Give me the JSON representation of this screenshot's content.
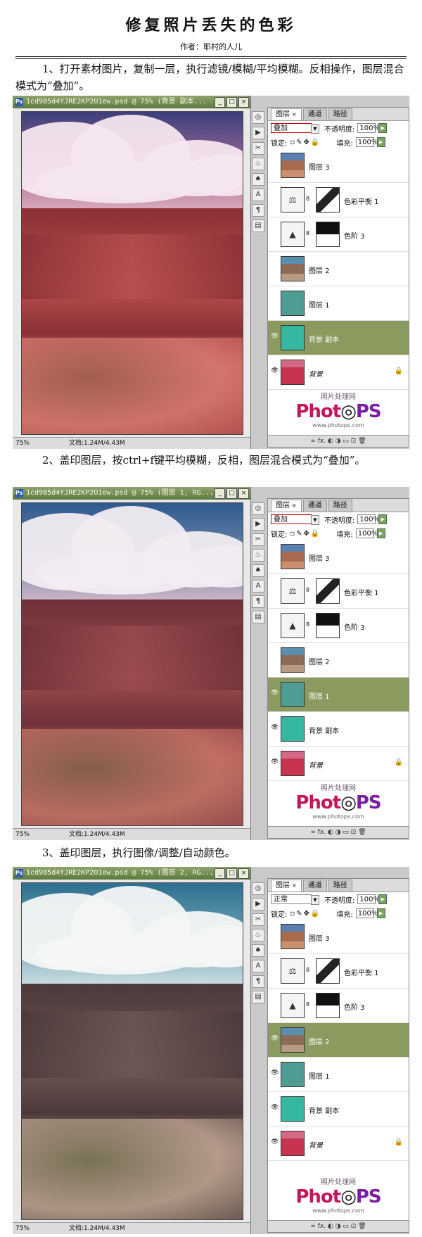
{
  "title": "修复照片丢失的色彩",
  "author": "作者：耶村的人儿",
  "steps": [
    "1、打开素材图片，复制一层，执行滤镜/模糊/平均模糊。反相操作，图层混合模式为“叠加”。",
    "2、盖印图层，按ctrl+f键平均模糊，反相，图层混合模式为“叠加”。",
    "3、盖印图层，执行图像/调整/自动颜色。"
  ],
  "shots": [
    {
      "doc_title": "1cd985d4YJRE2KP2O1ew.psd @ 75% (背景 副本...",
      "blend": "叠加",
      "selected_layer": "背景 副本",
      "visible_layers": [
        "背景 副本",
        "背景"
      ]
    },
    {
      "doc_title": "1cd985d4YJRE2KP2O1ew.psd @ 75% (图层 1, RG...",
      "blend": "叠加",
      "selected_layer": "图层 1",
      "visible_layers": [
        "图层 1",
        "背景 副本",
        "背景"
      ]
    },
    {
      "doc_title": "1cd985d4YJRE2KP2O1ew.psd @ 75% (图层 2, RG...",
      "blend": "正常",
      "selected_layer": "图层 2",
      "visible_layers": [
        "图层 2",
        "图层 1",
        "背景 副本",
        "背景"
      ]
    }
  ],
  "ui": {
    "tab_layers": "图层",
    "tab_channels": "通道",
    "tab_paths": "路径",
    "opacity_label": "不透明度:",
    "opacity_value": "100%",
    "lock_label": "锁定:",
    "fill_label": "填充:",
    "fill_value": "100%",
    "zoom": "75%",
    "doc_size": "文档:1.24M/4.43M",
    "brand_sub": "照片处理网",
    "brand_logo_a": "Phot",
    "brand_logo_b": "PS",
    "brand_url": "www.photops.com",
    "footer_icons": "∞  fx.  ◐  ◑  ▭  ⊡  🗑"
  },
  "layer_names": [
    "图层 3",
    "色彩平衡 1",
    "色阶 3",
    "图层 2",
    "图层 1",
    "背景 副本",
    "背景"
  ]
}
